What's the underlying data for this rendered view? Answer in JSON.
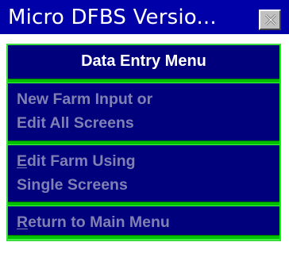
{
  "window": {
    "title": "Micro DFBS Versio...",
    "close_icon": "close-x-icon"
  },
  "menu": {
    "header": "Data Entry Menu",
    "items": [
      {
        "lines": [
          "New Farm Input or",
          "Edit All Screens"
        ],
        "mnemonic": ""
      },
      {
        "lines": [
          "Edit Farm Using",
          "Single Screens"
        ],
        "mnemonic": "E"
      },
      {
        "lines": [
          "Return to Main Menu"
        ],
        "mnemonic": "R"
      }
    ]
  },
  "colors": {
    "titlebar": "#0000a8",
    "menu_background": "#00007c",
    "separator": "#00c000",
    "menu_text_disabled": "#8080b4",
    "header_text": "#ffffff"
  }
}
